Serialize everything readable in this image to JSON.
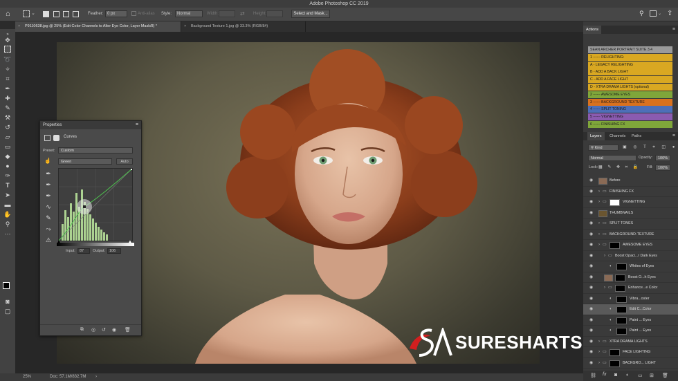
{
  "app_title": "Adobe Photoshop CC 2019",
  "options_bar": {
    "feather_label": "Feather:",
    "feather_value": "0 px",
    "anti_alias_label": "Anti-alias",
    "style_label": "Style:",
    "style_value": "Normal",
    "width_label": "Width:",
    "height_label": "Height:",
    "select_mask_label": "Select and Mask..."
  },
  "tabs": [
    {
      "label": "P9110638.jpg @ 25% (Edit Color Channels to Alter Eye Color, Layer Mask/8) *",
      "active": true
    },
    {
      "label": "Background Texture 1.jpg @ 33.3% (RGB/8#)",
      "active": false
    }
  ],
  "status": {
    "zoom": "25%",
    "doc": "Doc: 57.1M/832.7M"
  },
  "properties": {
    "title": "Properties",
    "adjustment": "Curves",
    "preset_label": "Preset:",
    "preset_value": "Custom",
    "channel_value": "Green",
    "auto_label": "Auto",
    "input_label": "Input:",
    "input_value": "87",
    "output_label": "Output:",
    "output_value": "106"
  },
  "actions": {
    "header": "Actions",
    "items": [
      {
        "label": "SEAN ARCHER PORTRAIT SUITE 3.4",
        "color": "#9a9a9a"
      },
      {
        "label": "1 ------ RELIGHTING:",
        "color": "#d9a822"
      },
      {
        "label": "A - LEGACY RELIGHTING",
        "color": "#d9a822"
      },
      {
        "label": "B - ADD A BACK LIGHT",
        "color": "#d9a822"
      },
      {
        "label": "C - ADD A FACE LIGHT",
        "color": "#d9a822"
      },
      {
        "label": "D - XTRA DRAMA LIGHTS (optional)",
        "color": "#d9a822"
      },
      {
        "label": "2 ------ AWESOME EYES",
        "color": "#7fa63a"
      },
      {
        "label": "3 ------ BACKGROUND TEXTURE",
        "color": "#d9711e"
      },
      {
        "label": "4 ------ SPLIT TONING",
        "color": "#4d6fb8"
      },
      {
        "label": "5 ------ VIGNETTING",
        "color": "#8a5bb0"
      },
      {
        "label": "6 ------ FINISHING FX",
        "color": "#7fa63a"
      }
    ]
  },
  "layers_panel": {
    "tabs": [
      "Layers",
      "Channels",
      "Paths"
    ],
    "filter_value": "Kind",
    "blend_mode": "Normal",
    "opacity_label": "Opacity:",
    "opacity_value": "100%",
    "lock_label": "Lock:",
    "fill_label": "Fill:",
    "fill_value": "100%",
    "layers": [
      {
        "name": "Before",
        "indent": 0,
        "type": "image"
      },
      {
        "name": "FINISHING FX",
        "indent": 0,
        "type": "group"
      },
      {
        "name": "VIGNETTING",
        "indent": 0,
        "type": "group-mask"
      },
      {
        "name": "THUMBNAILS",
        "indent": 0,
        "type": "image"
      },
      {
        "name": "SPLIT TONES",
        "indent": 0,
        "type": "group"
      },
      {
        "name": "BACKGROUND-TEXTURE",
        "indent": 0,
        "type": "group"
      },
      {
        "name": "AWESOME EYES",
        "indent": 0,
        "type": "group-mask"
      },
      {
        "name": "Boost Opaci...r Dark Eyes",
        "indent": 1,
        "type": "group"
      },
      {
        "name": "Whites of Eyes",
        "indent": 2,
        "type": "adjust"
      },
      {
        "name": "Boost O...h Eyes",
        "indent": 1,
        "type": "image-mask"
      },
      {
        "name": "Enhance...e Color",
        "indent": 1,
        "type": "group-mask"
      },
      {
        "name": "Vibra...oster",
        "indent": 2,
        "type": "adjust"
      },
      {
        "name": "Edit C...Color",
        "indent": 2,
        "type": "adjust",
        "selected": true
      },
      {
        "name": "Paint ... Eyes",
        "indent": 2,
        "type": "adjust"
      },
      {
        "name": "Paint ... Eyes",
        "indent": 2,
        "type": "adjust"
      },
      {
        "name": "XTRA DRAMA LIGHTS",
        "indent": 0,
        "type": "group"
      },
      {
        "name": "FACE LIGHTING",
        "indent": 0,
        "type": "group-mask"
      },
      {
        "name": "BACKGRO... LIGHT",
        "indent": 0,
        "type": "group-mask"
      },
      {
        "name": "RELIGHTING",
        "indent": 0,
        "type": "group"
      }
    ]
  },
  "watermark": "SURESHARTS.COM"
}
